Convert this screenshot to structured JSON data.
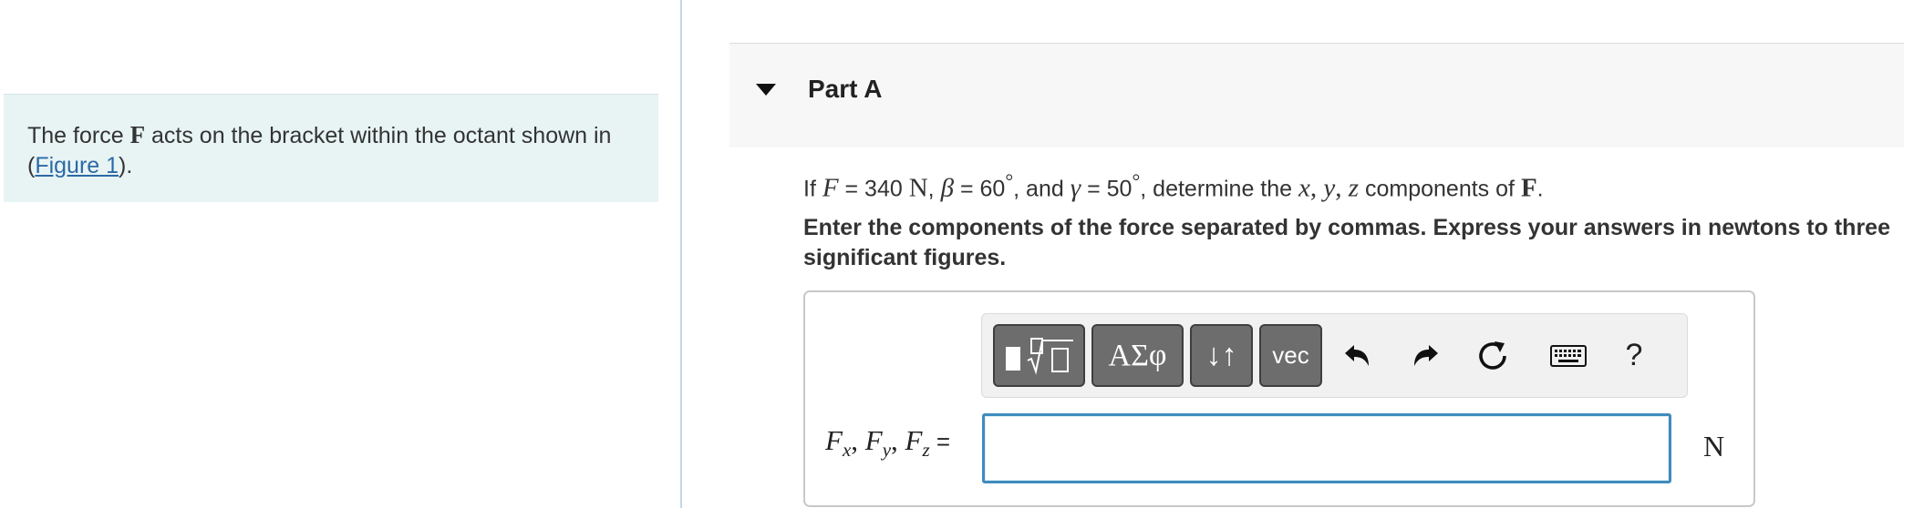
{
  "intro": {
    "text_before": "The force ",
    "force_symbol": "F",
    "text_after": " acts on the bracket within the octant shown in (",
    "figure_link": "Figure 1",
    "text_end": ")."
  },
  "part": {
    "title": "Part A"
  },
  "question": {
    "t1": "If ",
    "F_sym": "F",
    "t2": " = 340 ",
    "unit_N": "N",
    "t3": ", ",
    "beta_sym": "β",
    "t4": " = 60",
    "deg1": "°",
    "t5": ", and ",
    "gamma_sym": "γ",
    "t6": " = 50",
    "deg2": "°",
    "t7": ", determine the ",
    "x_sym": "x",
    "c1": ", ",
    "y_sym": "y",
    "c2": ", ",
    "z_sym": "z",
    "t8": " components of ",
    "F_bold": "F",
    "t9": "."
  },
  "instructions": "Enter the components of the force separated by commas. Express your answers in newtons to three significant figures.",
  "toolbar": {
    "symbols_label": "ΑΣφ",
    "updown_label": "↓↑",
    "vec_label": "vec",
    "help_label": "?"
  },
  "answer": {
    "label_F1": "F",
    "label_sub1": "x",
    "label_sep1": ", ",
    "label_F2": "F",
    "label_sub2": "y",
    "label_sep2": ", ",
    "label_F3": "F",
    "label_sub3": "z",
    "label_eq": " =",
    "value": "",
    "unit": "N"
  },
  "colors": {
    "intro_bg": "#e8f4f4",
    "link": "#2b6aa6",
    "input_border": "#3f8bbd",
    "toolbar_button": "#6d6d6d"
  },
  "icons": [
    "templates-icon",
    "undo-icon",
    "redo-icon",
    "reset-icon",
    "keyboard-icon",
    "help-icon"
  ]
}
